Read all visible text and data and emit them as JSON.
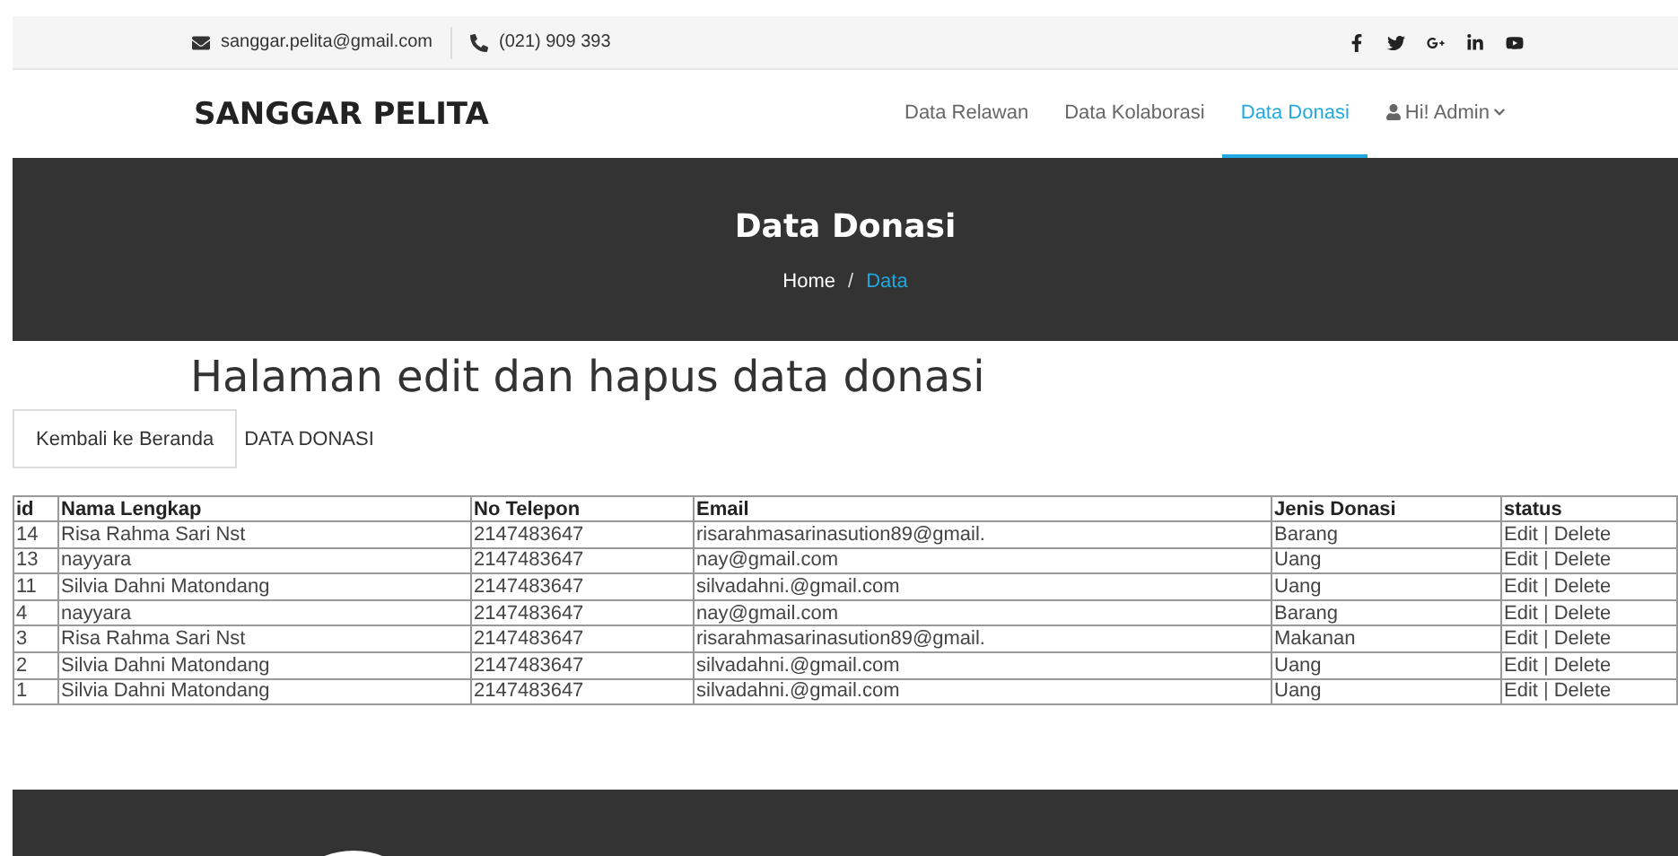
{
  "topbar": {
    "email": "sanggar.pelita@gmail.com",
    "phone": "(021) 909 393"
  },
  "navbar": {
    "brand": "SANGGAR PELITA",
    "items": [
      {
        "label": "Data Relawan",
        "selected": false,
        "kind": "link"
      },
      {
        "label": "Data Kolaborasi",
        "selected": false,
        "kind": "link"
      },
      {
        "label": "Data Donasi",
        "selected": true,
        "kind": "link"
      },
      {
        "label": "Hi! Admin",
        "selected": false,
        "kind": "user"
      }
    ]
  },
  "hero": {
    "title": "Data Donasi",
    "breadcrumb": [
      {
        "label": "Home",
        "selected": false
      },
      {
        "label": "/",
        "selected": false,
        "kind": "separator"
      },
      {
        "label": "Data",
        "selected": true
      }
    ]
  },
  "content": {
    "heading": "Halaman edit dan hapus data donasi",
    "back_button": "Kembali ke Beranda",
    "section_label": "DATA DONASI"
  },
  "table": {
    "columns": [
      "id",
      "Nama Lengkap",
      "No Telepon",
      "Email",
      "Jenis Donasi",
      "status"
    ],
    "rows": [
      {
        "cells": [
          "14",
          "Risa Rahma Sari Nst",
          "2147483647",
          "risarahmasarinasution89@gmail.",
          "Barang"
        ],
        "status": [
          {
            "kind": "link",
            "text": "Edit"
          },
          {
            "kind": "separator",
            "text": "|"
          },
          {
            "kind": "link",
            "text": "Delete"
          }
        ]
      },
      {
        "cells": [
          "13",
          "nayyara",
          "2147483647",
          "nay@gmail.com",
          "Uang"
        ],
        "status": [
          {
            "kind": "link",
            "text": "Edit"
          },
          {
            "kind": "separator",
            "text": "|"
          },
          {
            "kind": "link",
            "text": "Delete"
          }
        ]
      },
      {
        "cells": [
          "11",
          "Silvia Dahni Matondang",
          "2147483647",
          "silvadahni.@gmail.com",
          "Uang"
        ],
        "status": [
          {
            "kind": "link",
            "text": "Edit"
          },
          {
            "kind": "separator",
            "text": "|"
          },
          {
            "kind": "link",
            "text": "Delete"
          }
        ]
      },
      {
        "cells": [
          "4",
          "nayyara",
          "2147483647",
          "nay@gmail.com",
          "Barang"
        ],
        "status": [
          {
            "kind": "link",
            "text": "Edit"
          },
          {
            "kind": "separator",
            "text": "|"
          },
          {
            "kind": "link",
            "text": "Delete"
          }
        ]
      },
      {
        "cells": [
          "3",
          "Risa Rahma Sari Nst",
          "2147483647",
          "risarahmasarinasution89@gmail.",
          "Makanan"
        ],
        "status": [
          {
            "kind": "link",
            "text": "Edit"
          },
          {
            "kind": "separator",
            "text": "|"
          },
          {
            "kind": "link",
            "text": "Delete"
          }
        ]
      },
      {
        "cells": [
          "2",
          "Silvia Dahni Matondang",
          "2147483647",
          "silvadahni.@gmail.com",
          "Uang"
        ],
        "status": [
          {
            "kind": "link",
            "text": "Edit"
          },
          {
            "kind": "separator",
            "text": "|"
          },
          {
            "kind": "link",
            "text": "Delete"
          }
        ]
      },
      {
        "cells": [
          "1",
          "Silvia Dahni Matondang",
          "2147483647",
          "silvadahni.@gmail.com",
          "Uang"
        ],
        "status": [
          {
            "kind": "link",
            "text": "Edit"
          },
          {
            "kind": "separator",
            "text": "|"
          },
          {
            "kind": "link",
            "text": "Delete"
          }
        ]
      }
    ]
  }
}
